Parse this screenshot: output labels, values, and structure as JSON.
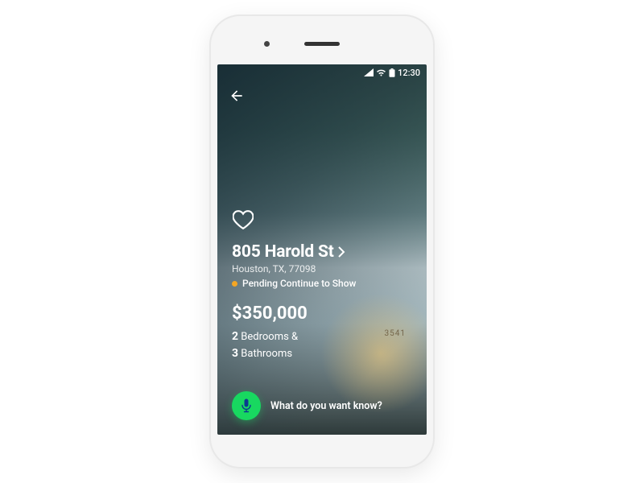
{
  "statusBar": {
    "time": "12:30"
  },
  "listing": {
    "address": "805 Harold St",
    "cityStateZip": "Houston, TX, 77098",
    "statusLabel": "Pending Continue to Show",
    "statusDotColor": "#f5a623",
    "price": "$350,000",
    "bedroomsCount": "2",
    "bedroomsLabel": "Bedrooms &",
    "bathroomsCount": "3",
    "bathroomsLabel": "Bathrooms",
    "houseNumber": "3541"
  },
  "voice": {
    "prompt": "What do you want know?",
    "micColor": "#18d860"
  }
}
